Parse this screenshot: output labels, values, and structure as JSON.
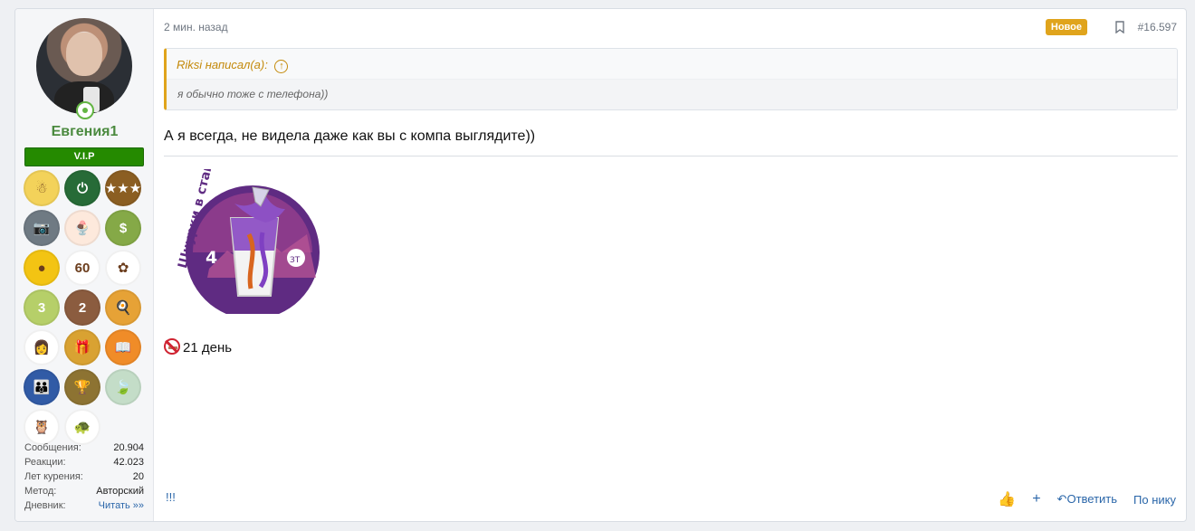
{
  "author": {
    "name": "Евгения1",
    "banner": "V.I.P",
    "online_icon": "online-status-icon",
    "trophies": [
      {
        "name": "snowman-award",
        "color": "#f3d25a",
        "symbol": "☃"
      },
      {
        "name": "power-award",
        "color": "#276b37",
        "symbol": "⏻"
      },
      {
        "name": "stars-award",
        "color": "#8b5e22",
        "symbol": "★★★"
      },
      {
        "name": "camera-award",
        "color": "#6f7a83",
        "symbol": "📷"
      },
      {
        "name": "icecream-award",
        "color": "#fde9dc",
        "symbol": "🍨"
      },
      {
        "name": "money-award",
        "color": "#85a947",
        "symbol": "$"
      },
      {
        "name": "egg-award",
        "color": "#f3c413",
        "symbol": "●"
      },
      {
        "name": "yoga-60-award",
        "color": "#fff",
        "symbol": "60"
      },
      {
        "name": "lotus-award",
        "color": "#fff",
        "symbol": "✿"
      },
      {
        "name": "three-award",
        "color": "#b6cf69",
        "symbol": "3"
      },
      {
        "name": "two-award",
        "color": "#8b5c3f",
        "symbol": "2"
      },
      {
        "name": "cook-award",
        "color": "#e6a236",
        "symbol": "🍳"
      },
      {
        "name": "girl-award",
        "color": "#fff",
        "symbol": "👩"
      },
      {
        "name": "chest-award",
        "color": "#d9a232",
        "symbol": "🎁"
      },
      {
        "name": "book-award",
        "color": "#f08c28",
        "symbol": "📖"
      },
      {
        "name": "people-award",
        "color": "#315ba6",
        "symbol": "👪"
      },
      {
        "name": "gold-cup-award",
        "color": "#8d7332",
        "symbol": "🏆"
      },
      {
        "name": "leaf-award",
        "color": "#c4ddc8",
        "symbol": "🍃"
      },
      {
        "name": "owl-award",
        "color": "#fff",
        "symbol": "🦉"
      },
      {
        "name": "turtle-award",
        "color": "#fff",
        "symbol": "🐢"
      }
    ],
    "stats": [
      {
        "label": "Сообщения:",
        "value": "20.904"
      },
      {
        "label": "Реакции:",
        "value": "42.023"
      },
      {
        "label": "Лет курения:",
        "value": "20"
      },
      {
        "label": "Метод:",
        "value": "Авторский"
      },
      {
        "label": "Дневник:",
        "value": "Читать »»"
      }
    ]
  },
  "post": {
    "time": "2 мин. назад",
    "badge": "Новое",
    "number": "#16.597",
    "quote_author": "Riksi написал(а):",
    "quote_text": "я обычно тоже с телефона))",
    "message": "А я всегда, не видела даже как вы с компа выглядите))",
    "sticker_text": "Шнурки в стакане",
    "sticker_number": "4",
    "streak": "21 день",
    "signature": "!!!"
  },
  "actions": {
    "reply": "Ответить",
    "by_nick": "По нику"
  },
  "colors": {
    "accent": "#e0a41c",
    "username": "#4b8a3f",
    "link": "#2a66a9",
    "vip": "#258a00"
  }
}
